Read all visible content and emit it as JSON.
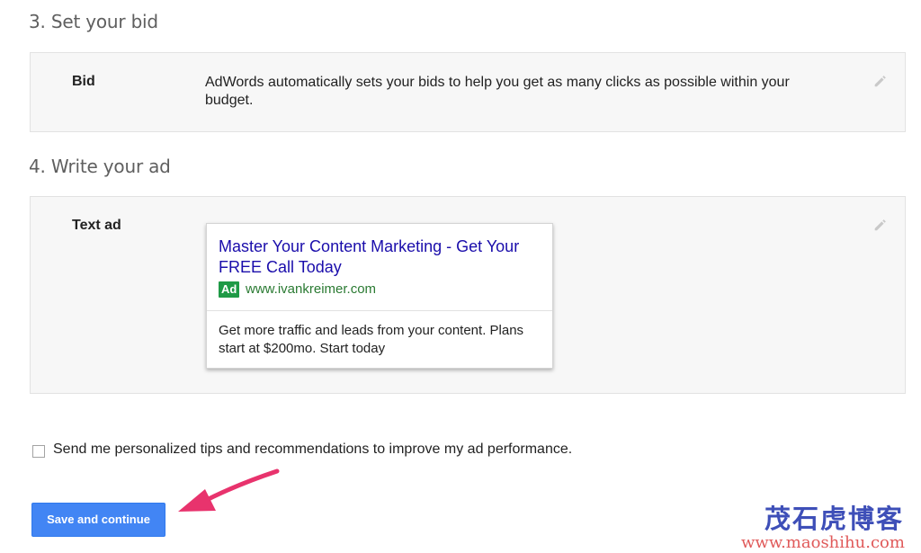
{
  "section_bid": {
    "heading": "3. Set your bid",
    "label": "Bid",
    "text": "AdWords automatically sets your bids to help you get as many clicks as possible within your budget.",
    "edit_icon": "pencil-icon"
  },
  "section_ad": {
    "heading": "4. Write your ad",
    "label": "Text ad",
    "edit_icon": "pencil-icon",
    "ad": {
      "headline": "Master Your Content Marketing - Get Your FREE Call Today",
      "badge": "Ad",
      "url": "www.ivankreimer.com",
      "description": "Get more traffic and leads from your content. Plans start at $200mo. Start today"
    }
  },
  "tips": {
    "label": "Send me personalized tips and recommendations to improve my ad performance.",
    "checked": false
  },
  "save_button": {
    "label": "Save and continue"
  },
  "watermark": {
    "chinese": "茂石虎博客",
    "url": "www.maoshihu.com"
  },
  "colors": {
    "button": "#4285f4",
    "headline_link": "#1a0dab",
    "ad_badge": "#1f9a46",
    "arrow": "#e8336d",
    "watermark_cn": "#3e4fb8",
    "watermark_url": "#e05a5a"
  }
}
